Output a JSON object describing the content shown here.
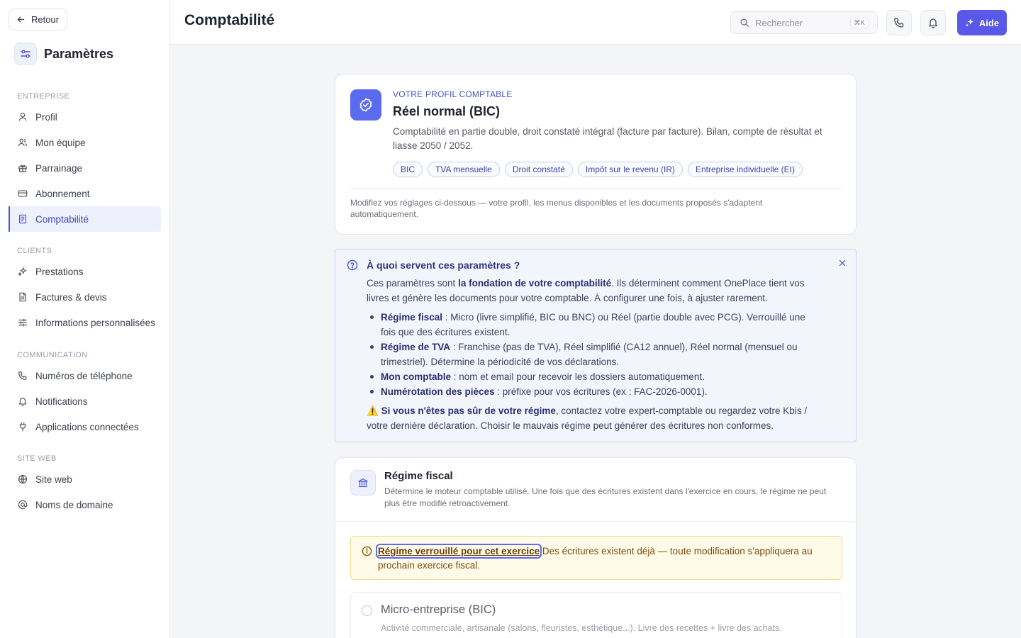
{
  "sidebar": {
    "back_label": "Retour",
    "title": "Paramètres",
    "sections": [
      {
        "heading": "ENTREPRISE",
        "items": [
          {
            "label": "Profil",
            "icon": "user-icon"
          },
          {
            "label": "Mon équipe",
            "icon": "users-icon"
          },
          {
            "label": "Parrainage",
            "icon": "gift-icon"
          },
          {
            "label": "Abonnement",
            "icon": "credit-card-icon"
          },
          {
            "label": "Comptabilité",
            "icon": "receipt-icon",
            "active": true
          }
        ]
      },
      {
        "heading": "CLIENTS",
        "items": [
          {
            "label": "Prestations",
            "icon": "sparkles-icon"
          },
          {
            "label": "Factures & devis",
            "icon": "file-icon"
          },
          {
            "label": "Informations personnalisées",
            "icon": "sliders-icon"
          }
        ]
      },
      {
        "heading": "COMMUNICATION",
        "items": [
          {
            "label": "Numéros de téléphone",
            "icon": "phone-icon"
          },
          {
            "label": "Notifications",
            "icon": "bell-icon"
          },
          {
            "label": "Applications connectées",
            "icon": "plug-icon"
          }
        ]
      },
      {
        "heading": "SITE WEB",
        "items": [
          {
            "label": "Site web",
            "icon": "globe-icon"
          },
          {
            "label": "Noms de domaine",
            "icon": "at-icon"
          }
        ]
      }
    ]
  },
  "header": {
    "title": "Comptabilité",
    "search_placeholder": "Rechercher",
    "search_shortcut": "⌘K",
    "help_label": "Aide"
  },
  "profile": {
    "kicker": "VOTRE PROFIL COMPTABLE",
    "title": "Réel normal (BIC)",
    "description": "Comptabilité en partie double, droit constaté intégral (facture par facture). Bilan, compte de résultat et liasse 2050 / 2052.",
    "tags": [
      "BIC",
      "TVA mensuelle",
      "Droit constaté",
      "Impôt sur le revenu (IR)",
      "Entreprise individuelle (EI)"
    ],
    "note": "Modifiez vos réglages ci-dessous — votre profil, les menus disponibles et les documents proposés s'adaptent automatiquement."
  },
  "info": {
    "title": "À quoi servent ces paramètres ?",
    "intro_before": "Ces paramètres sont ",
    "intro_bold": "la fondation de votre comptabilité",
    "intro_after": ". Ils déterminent comment OnePlace tient vos livres et génère les documents pour votre comptable. À configurer une fois, à ajuster rarement.",
    "items": [
      {
        "term": "Régime fiscal",
        "text": " : Micro (livre simplifié, BIC ou BNC) ou Réel (partie double avec PCG). Verrouillé une fois que des écritures existent."
      },
      {
        "term": "Régime de TVA",
        "text": " : Franchise (pas de TVA), Réel simplifié (CA12 annuel), Réel normal (mensuel ou trimestriel). Détermine la périodicité de vos déclarations."
      },
      {
        "term": "Mon comptable",
        "text": " : nom et email pour recevoir les dossiers automatiquement."
      },
      {
        "term": "Numérotation des pièces",
        "text": " : préfixe pour vos écritures (ex : FAC-2026-0001)."
      }
    ],
    "warning_icon": "⚠️",
    "warning_bold": "Si vous n'êtes pas sûr de votre régime",
    "warning_text": ", contactez votre expert-comptable ou regardez votre Kbis / votre dernière déclaration. Choisir le mauvais régime peut générer des écritures non conformes."
  },
  "regime": {
    "title": "Régime fiscal",
    "description": "Détermine le moteur comptable utilisé. Une fois que des écritures existent dans l'exercice en cours, le régime ne peut plus être modifié rétroactivement.",
    "lock_bold": "Régime verrouillé pour cet exercice",
    "lock_text": " Des écritures existent déjà — toute modification s'appliquera au prochain exercice fiscal.",
    "option_title": "Micro-entreprise (BIC)",
    "option_desc": "Activité commerciale, artisanale (salons, fleuristes, esthétique...). Livre des recettes + livre des achats."
  },
  "colors": {
    "accent": "#5a58e8",
    "active_nav": "#3f47b8",
    "profile_icon": "#5b6bf0",
    "warning_bg": "#fffbe8"
  }
}
